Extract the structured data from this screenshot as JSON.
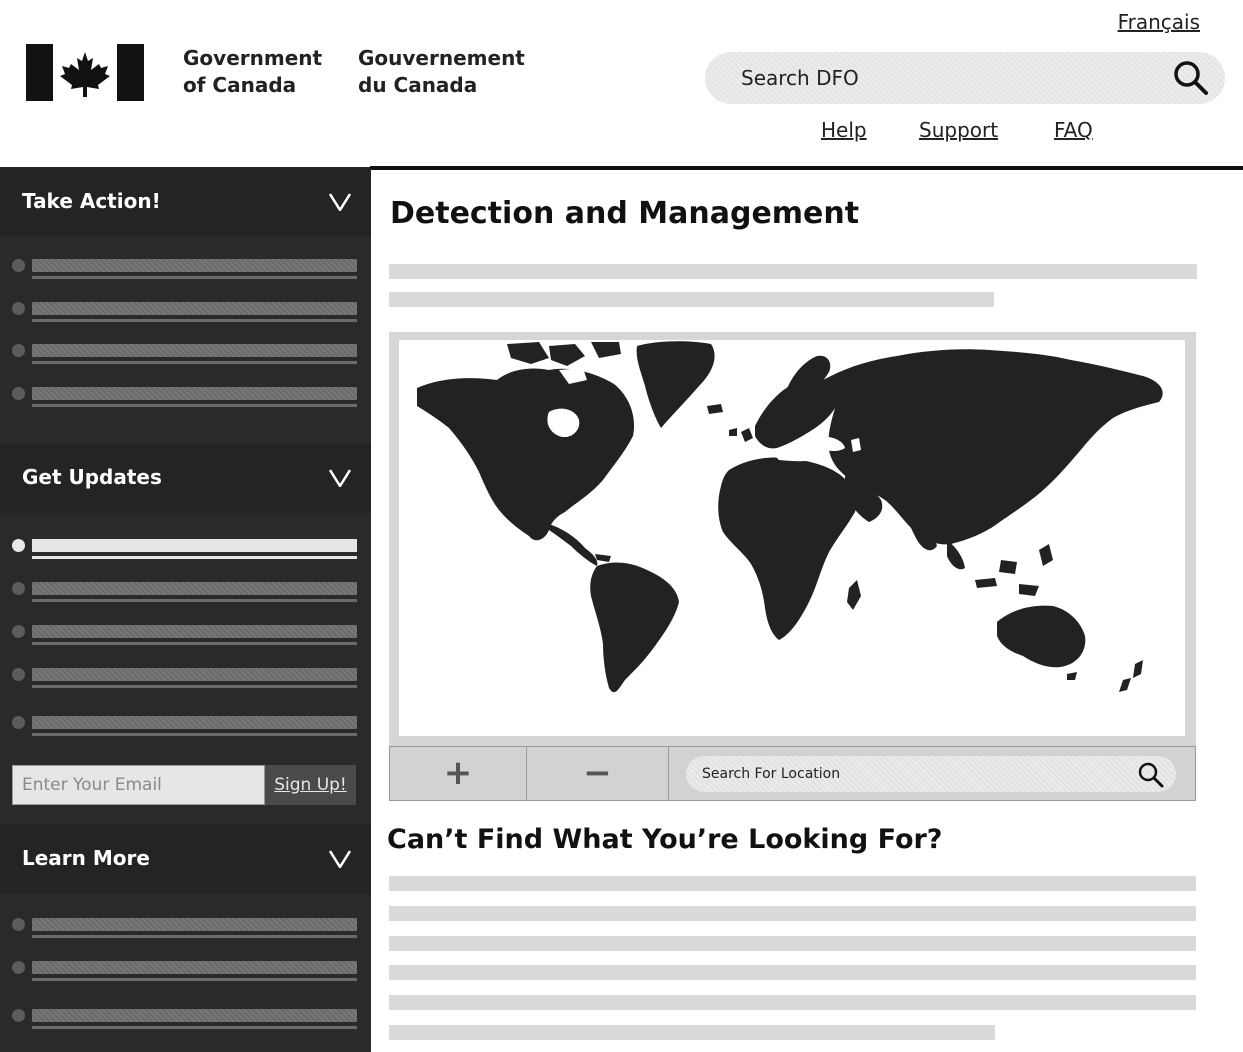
{
  "header": {
    "language_link": "Français",
    "gov_en_line1": "Government",
    "gov_en_line2": "of Canada",
    "gov_fr_line1": "Gouvernement",
    "gov_fr_line2": "du Canada",
    "search_placeholder": "Search DFO",
    "links": {
      "help": "Help",
      "support": "Support",
      "faq": "FAQ"
    }
  },
  "sidebar": {
    "sections": {
      "take_action": {
        "title": "Take Action!",
        "item_count": 4
      },
      "get_updates": {
        "title": "Get Updates",
        "item_count": 5,
        "active_item": 1
      },
      "learn_more": {
        "title": "Learn More",
        "item_count": 3
      }
    },
    "email_placeholder": "Enter Your Email",
    "signup_label": "Sign Up!"
  },
  "main": {
    "title": "Detection and Management",
    "map": {
      "zoom_in_label": "+",
      "zoom_out_label": "−",
      "location_placeholder": "Search For Location"
    },
    "help_title": "Can’t Find What You’re Looking For?"
  },
  "colors": {
    "sidebar_bg": "#2a2a2a",
    "section_header_bg": "#242424",
    "placeholder_text_bar": "#d9d9d9",
    "map_land": "#222222"
  },
  "icons": [
    "canada-flag-icon",
    "search-icon",
    "chevron-down-icon",
    "world-map"
  ]
}
